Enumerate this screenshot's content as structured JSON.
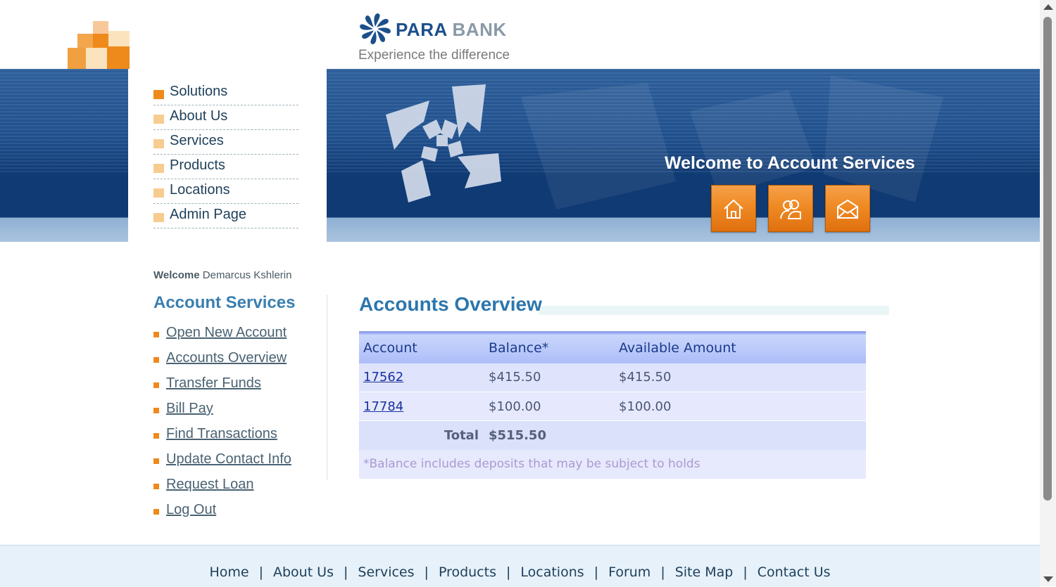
{
  "brand": {
    "name_part1": "PARA",
    "name_part2": "BANK",
    "tagline": "Experience the difference"
  },
  "top_nav": [
    {
      "label": "Solutions"
    },
    {
      "label": "About Us"
    },
    {
      "label": "Services"
    },
    {
      "label": "Products"
    },
    {
      "label": "Locations"
    },
    {
      "label": "Admin Page"
    }
  ],
  "banner": {
    "title": "Welcome to Account Services",
    "buttons": [
      {
        "icon": "home-icon"
      },
      {
        "icon": "contact-people-icon"
      },
      {
        "icon": "envelope-icon"
      }
    ]
  },
  "user": {
    "welcome_label": "Welcome",
    "name": "Demarcus Kshlerin"
  },
  "sidebar": {
    "title": "Account Services",
    "items": [
      {
        "label": "Open New Account"
      },
      {
        "label": "Accounts Overview"
      },
      {
        "label": "Transfer Funds"
      },
      {
        "label": "Bill Pay"
      },
      {
        "label": "Find Transactions"
      },
      {
        "label": "Update Contact Info"
      },
      {
        "label": "Request Loan"
      },
      {
        "label": "Log Out"
      }
    ]
  },
  "main": {
    "title": "Accounts Overview",
    "table": {
      "headers": [
        "Account",
        "Balance*",
        "Available Amount"
      ],
      "rows": [
        {
          "account": "17562",
          "balance": "$415.50",
          "available": "$415.50"
        },
        {
          "account": "17784",
          "balance": "$100.00",
          "available": "$100.00"
        }
      ],
      "total_label": "Total",
      "total_value": "$515.50",
      "note": "*Balance includes deposits that may be subject to holds"
    }
  },
  "footer": {
    "links": [
      "Home",
      "About Us",
      "Services",
      "Products",
      "Locations",
      "Forum",
      "Site Map",
      "Contact Us"
    ],
    "separator": "|"
  },
  "colors": {
    "accent_orange": "#ee8a1b",
    "brand_blue": "#1c4f8a",
    "heading_blue": "#2c76ad"
  }
}
